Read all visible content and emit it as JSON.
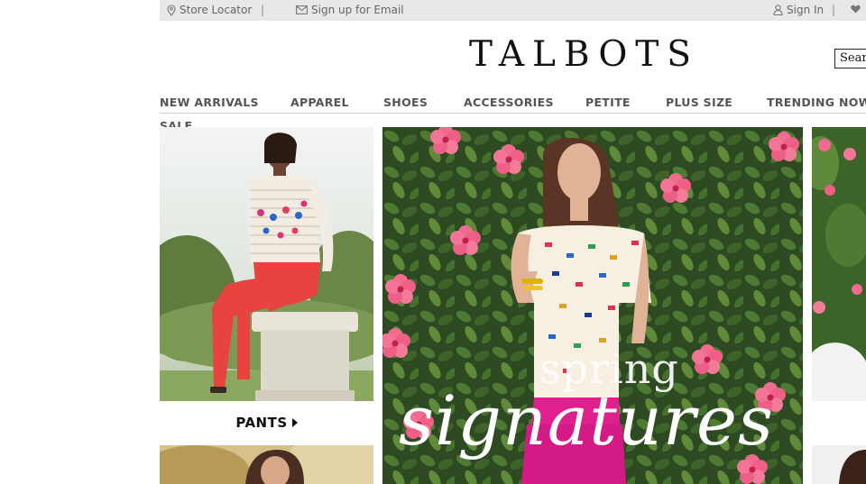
{
  "topbar": {
    "store_locator": "Store Locator",
    "separator": "|",
    "email_signup": "Sign up for Email",
    "sign_in": "Sign In"
  },
  "header": {
    "logo": "TALBOTS",
    "search_placeholder": "Search"
  },
  "nav": {
    "items": [
      "NEW ARRIVALS",
      "APPAREL",
      "SHOES",
      "ACCESSORIES",
      "PETITE",
      "PLUS SIZE",
      "TRENDING NOW"
    ],
    "sale": "SALE"
  },
  "tiles": {
    "pants_label": "PANTS"
  },
  "hero": {
    "line1": "spring",
    "line2": "signatures"
  },
  "colors": {
    "topbar_bg": "#e8e8e8",
    "nav_text": "#555555",
    "pink_pants": "#e0208e",
    "coral_pants": "#e8433e"
  }
}
